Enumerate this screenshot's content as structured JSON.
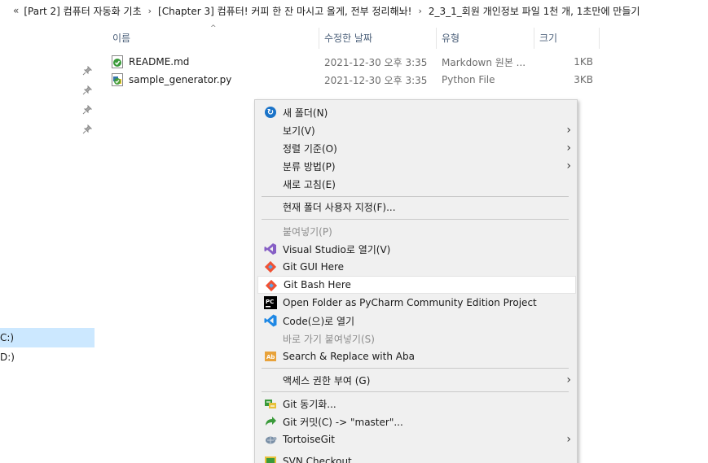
{
  "breadcrumb": {
    "overflow": "«",
    "items": [
      "[Part 2] 컴퓨터 자동화 기초",
      "[Chapter 3] 컴퓨터! 커피 한 잔 마시고 올게, 전부 정리해놔!",
      "2_3_1_회원 개인정보 파일 1천 개, 1초만에 만들기"
    ],
    "separator": "›"
  },
  "nav": {
    "drives": [
      {
        "label": "C:)",
        "selected": true
      },
      {
        "label": "D:)",
        "selected": false
      }
    ]
  },
  "columns": {
    "name": "이름",
    "modified": "수정한 날짜",
    "type": "유형",
    "size": "크기"
  },
  "files": [
    {
      "name": "README.md",
      "modified": "2021-12-30 오후 3:35",
      "type": "Markdown 원본 ...",
      "size": "1KB",
      "icon": "markdown-file-icon"
    },
    {
      "name": "sample_generator.py",
      "modified": "2021-12-30 오후 3:35",
      "type": "Python File",
      "size": "3KB",
      "icon": "python-file-icon"
    }
  ],
  "context_menu": {
    "items": [
      {
        "label": "새 폴더(N)",
        "icon": "new-folder-icon"
      },
      {
        "label": "보기(V)",
        "submenu": true
      },
      {
        "label": "정렬 기준(O)",
        "submenu": true
      },
      {
        "label": "분류 방법(P)",
        "submenu": true
      },
      {
        "label": "새로 고침(E)"
      },
      {
        "label": "현재 폴더 사용자 지정(F)..."
      },
      {
        "label": "붙여넣기(P)",
        "disabled": true
      },
      {
        "label": "Visual Studio로 열기(V)",
        "icon": "visual-studio-icon"
      },
      {
        "label": "Git GUI Here",
        "icon": "git-gui-icon"
      },
      {
        "label": "Git Bash Here",
        "icon": "git-bash-icon"
      },
      {
        "label": "Open Folder as PyCharm Community Edition Project",
        "icon": "pycharm-icon"
      },
      {
        "label": "Code(으)로 열기",
        "icon": "vscode-icon"
      },
      {
        "label": "바로 가기 붙여넣기(S)",
        "disabled": true
      },
      {
        "label": "Search & Replace with Aba",
        "icon": "aba-icon"
      },
      {
        "label": "액세스 권한 부여 (G)",
        "submenu": true
      },
      {
        "label": "Git 동기화...",
        "icon": "git-sync-icon"
      },
      {
        "label": "Git 커밋(C) -> \"master\"...",
        "icon": "git-commit-icon"
      },
      {
        "label": "TortoiseGit",
        "icon": "tortoisegit-icon",
        "submenu": true
      },
      {
        "label": "SVN Checkout...",
        "icon": "svn-checkout-icon"
      }
    ],
    "submenu_glyph": "›"
  },
  "colors": {
    "nav_selected": "#cce8ff",
    "menu_bg": "#f0f0f0",
    "header_text": "#4c607a",
    "vs_purple": "#865fc5",
    "vscode_blue": "#1e88e5",
    "git_orange": "#f05133"
  }
}
